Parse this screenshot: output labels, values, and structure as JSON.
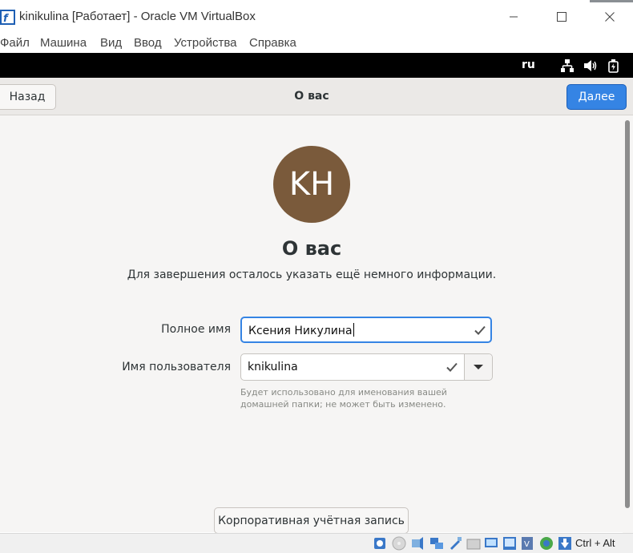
{
  "window": {
    "title": "kinikulina [Работает] - Oracle VM VirtualBox",
    "controls": {
      "minimize": "—",
      "maximize": "☐",
      "close": "✕"
    }
  },
  "menubar": {
    "items": [
      "Файл",
      "Машина",
      "Вид",
      "Ввод",
      "Устройства",
      "Справка"
    ]
  },
  "topbar": {
    "language": "ru",
    "icons": [
      "network-icon",
      "volume-icon",
      "battery-icon"
    ]
  },
  "header": {
    "back_label": "Назад",
    "title": "О вас",
    "next_label": "Далее"
  },
  "main": {
    "avatar_initials": "KH",
    "avatar_color": "#7a5a3b",
    "heading": "О вас",
    "subtitle": "Для завершения осталось указать ещё немного информации.",
    "fullname_label": "Полное имя",
    "fullname_value": "Ксения Никулина",
    "username_label": "Имя пользователя",
    "username_value": "knikulina",
    "username_hint": "Будет использовано для именования вашей домашней папки; не может быть изменено.",
    "enterprise_button": "Корпоративная учётная запись"
  },
  "statusbar": {
    "host_key": "Ctrl + Alt"
  },
  "colors": {
    "accent": "#3584e4",
    "content_bg": "#f6f5f4",
    "header_bg": "#ebe9e7"
  }
}
